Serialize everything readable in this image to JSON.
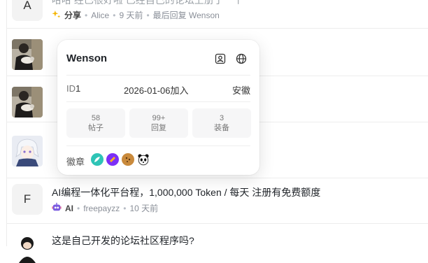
{
  "topics": [
    {
      "avatar_letter": "A",
      "title": "哈哈 经已很好啦 已经自己的论坛上册了一个",
      "category": "分享",
      "category_icon": "sparkles-icon",
      "author": "Alice",
      "time": "9 天前",
      "last_reply": "最后回复 Wenson"
    },
    {
      "avatar": "photo-man-with-cat"
    },
    {
      "avatar": "photo-man-with-cat"
    },
    {
      "avatar": "anime-character"
    },
    {
      "avatar_letter": "F",
      "title": "AI编程一体化平台程，1,000,000 Token / 每天 注册有免费额度",
      "category": "AI",
      "category_icon": "robot-icon",
      "author": "freepayzz",
      "time": "10 天前"
    },
    {
      "avatar": "cartoon-figure",
      "title": "这是自己开发的论坛社区程序吗?"
    }
  ],
  "popover": {
    "name": "Wenson",
    "id_label": "ID",
    "id_value": "1",
    "joined": "2026-01-06加入",
    "location": "安徽",
    "stats": [
      {
        "value": "58",
        "label": "帖子"
      },
      {
        "value": "99+",
        "label": "回复"
      },
      {
        "value": "3",
        "label": "装备"
      }
    ],
    "badges_label": "徽章",
    "badges": [
      "feather-badge-icon",
      "rocket-badge-icon",
      "cookie-badge-icon",
      "panda-badge-icon"
    ]
  },
  "colors": {
    "badge_teal": "#2ec4b6",
    "badge_purple": "#7b2ff7",
    "cookie": "#c98a3c"
  }
}
